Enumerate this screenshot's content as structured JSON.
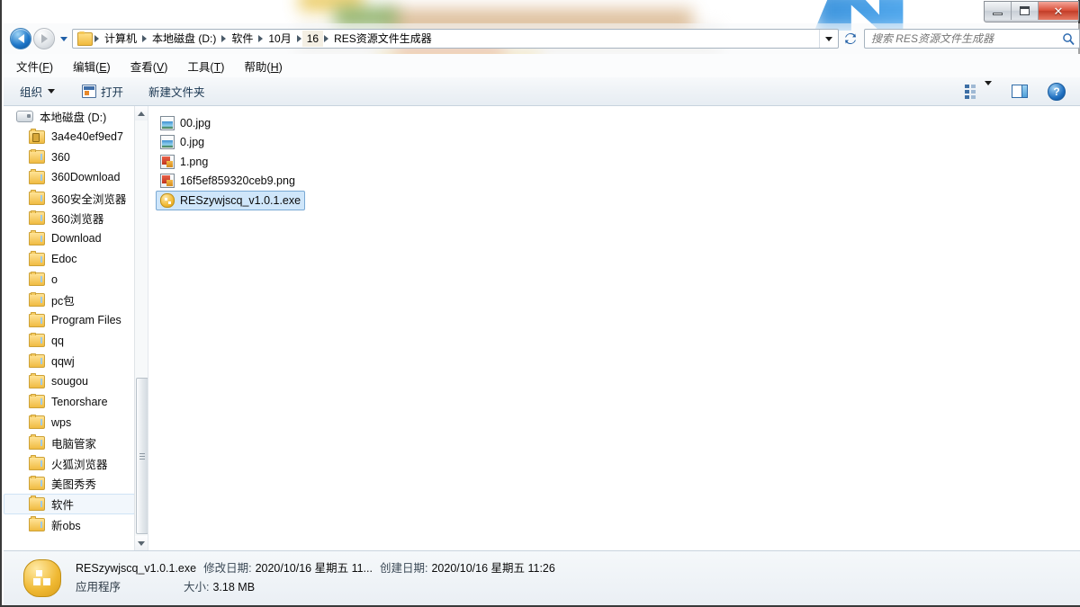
{
  "window": {
    "controls": {
      "minimize": "minimize-button",
      "maximize": "maximize-button",
      "close": "✕"
    }
  },
  "address_bar": {
    "back_tooltip": "后退",
    "forward_tooltip": "前进",
    "breadcrumbs": [
      {
        "label": "计算机",
        "current": false
      },
      {
        "label": "本地磁盘 (D:)",
        "current": false
      },
      {
        "label": "软件",
        "current": false
      },
      {
        "label": "10月",
        "current": false
      },
      {
        "label": "16",
        "current": true
      },
      {
        "label": "RES资源文件生成器",
        "current": false
      }
    ],
    "refresh_label": "刷新"
  },
  "search": {
    "placeholder": "搜索 RES资源文件生成器",
    "value": ""
  },
  "menubar": {
    "items": [
      {
        "text": "文件",
        "accel": "F"
      },
      {
        "text": "编辑",
        "accel": "E"
      },
      {
        "text": "查看",
        "accel": "V"
      },
      {
        "text": "工具",
        "accel": "T"
      },
      {
        "text": "帮助",
        "accel": "H"
      }
    ]
  },
  "toolbar": {
    "organize_label": "组织",
    "open_label": "打开",
    "new_folder_label": "新建文件夹",
    "help_glyph": "?"
  },
  "nav_pane": {
    "items": [
      {
        "label": "本地磁盘 (D:)",
        "icon": "drive-icon",
        "selected": false,
        "root": true
      },
      {
        "label": "3a4e40ef9ed7",
        "icon": "locked-folder-icon",
        "selected": false,
        "root": false
      },
      {
        "label": "360",
        "icon": "folder-icon",
        "selected": false,
        "root": false
      },
      {
        "label": "360Download",
        "icon": "folder-icon",
        "selected": false,
        "root": false
      },
      {
        "label": "360安全浏览器",
        "icon": "folder-icon",
        "selected": false,
        "root": false
      },
      {
        "label": "360浏览器",
        "icon": "folder-icon",
        "selected": false,
        "root": false
      },
      {
        "label": "Download",
        "icon": "folder-icon",
        "selected": false,
        "root": false
      },
      {
        "label": "Edoc",
        "icon": "folder-icon",
        "selected": false,
        "root": false
      },
      {
        "label": "o",
        "icon": "folder-icon",
        "selected": false,
        "root": false
      },
      {
        "label": "pc包",
        "icon": "folder-icon",
        "selected": false,
        "root": false
      },
      {
        "label": "Program Files",
        "icon": "folder-icon",
        "selected": false,
        "root": false
      },
      {
        "label": "qq",
        "icon": "folder-icon",
        "selected": false,
        "root": false
      },
      {
        "label": "qqwj",
        "icon": "folder-icon",
        "selected": false,
        "root": false
      },
      {
        "label": "sougou",
        "icon": "folder-icon",
        "selected": false,
        "root": false
      },
      {
        "label": "Tenorshare",
        "icon": "folder-icon",
        "selected": false,
        "root": false
      },
      {
        "label": "wps",
        "icon": "folder-icon",
        "selected": false,
        "root": false
      },
      {
        "label": "电脑管家",
        "icon": "folder-icon",
        "selected": false,
        "root": false
      },
      {
        "label": "火狐浏览器",
        "icon": "folder-icon",
        "selected": false,
        "root": false
      },
      {
        "label": "美图秀秀",
        "icon": "folder-icon",
        "selected": false,
        "root": false
      },
      {
        "label": "软件",
        "icon": "folder-icon",
        "selected": true,
        "root": false
      },
      {
        "label": "新obs",
        "icon": "folder-icon",
        "selected": false,
        "root": false
      }
    ]
  },
  "file_list": {
    "items": [
      {
        "name": "00.jpg",
        "icon": "jpg-image-icon",
        "selected": false
      },
      {
        "name": "0.jpg",
        "icon": "jpg-image-icon",
        "selected": false
      },
      {
        "name": "1.png",
        "icon": "png-image-icon",
        "selected": false
      },
      {
        "name": "16f5ef859320ceb9.png",
        "icon": "png-image-icon",
        "selected": false
      },
      {
        "name": "RESzywjscq_v1.0.1.exe",
        "icon": "exe-application-icon",
        "selected": true
      }
    ]
  },
  "status_bar": {
    "file_name": "RESzywjscq_v1.0.1.exe",
    "modified_label": "修改日期:",
    "modified_value": "2020/10/16 星期五 11...",
    "created_label": "创建日期:",
    "created_value": "2020/10/16 星期五 11:26",
    "file_type": "应用程序",
    "size_label": "大小:",
    "size_value": "3.18 MB"
  }
}
